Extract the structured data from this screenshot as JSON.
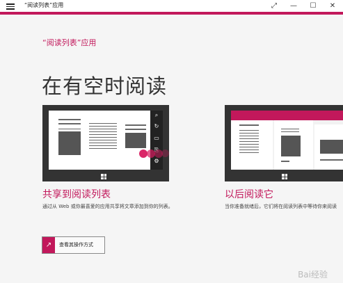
{
  "window": {
    "title": "“阅读列表”应用",
    "controls": [
      "⤢",
      "—",
      "☐",
      "✕"
    ]
  },
  "header": {
    "app_name": "“阅读列表”应用",
    "headline": "在有空时阅读"
  },
  "cards": [
    {
      "title": "共享到阅读列表",
      "description": "通过从 Web 或你最喜爱的应用共享将文章添加到你的列表。"
    },
    {
      "title": "以后阅读它",
      "description": "当你准备就绪后，它们将在阅读列表中等待你来阅读"
    }
  ],
  "action": {
    "label": "查看其操作方式",
    "icon": "arrow-up-right-icon"
  },
  "charms": [
    "⌕",
    "↻",
    "▭",
    "⎘",
    "⚙"
  ],
  "watermark": "Bai经验",
  "colors": {
    "accent": "#c2185b",
    "device": "#333333"
  }
}
